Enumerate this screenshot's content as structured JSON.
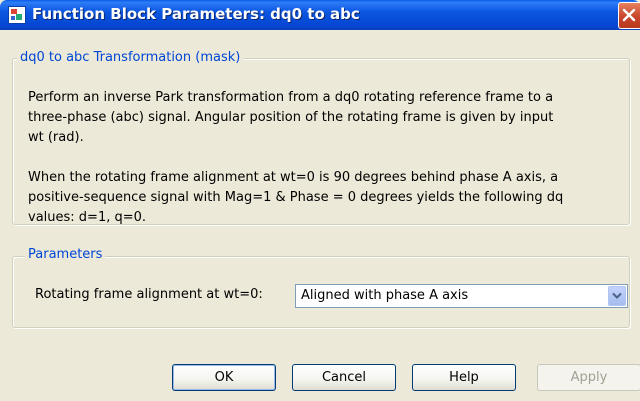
{
  "window": {
    "title": "Function Block Parameters: dq0 to abc",
    "icon": "simulink-block-icon"
  },
  "mask": {
    "legend": "dq0 to abc Transformation (mask)",
    "description_lines": [
      "Perform an inverse Park transformation from a dq0 rotating reference frame to a",
      "three-phase (abc) signal. Angular position of the rotating frame is given by input",
      "wt (rad).",
      "",
      "When the rotating frame alignment at wt=0 is 90 degrees behind phase A axis, a",
      "positive-sequence signal with Mag=1 & Phase = 0 degrees yields the following dq",
      "values: d=1, q=0."
    ]
  },
  "parameters": {
    "legend": "Parameters",
    "alignment_label": "Rotating frame alignment at wt=0:",
    "alignment_value": "Aligned with phase A axis"
  },
  "buttons": {
    "ok": "OK",
    "cancel": "Cancel",
    "help": "Help",
    "apply": "Apply"
  }
}
